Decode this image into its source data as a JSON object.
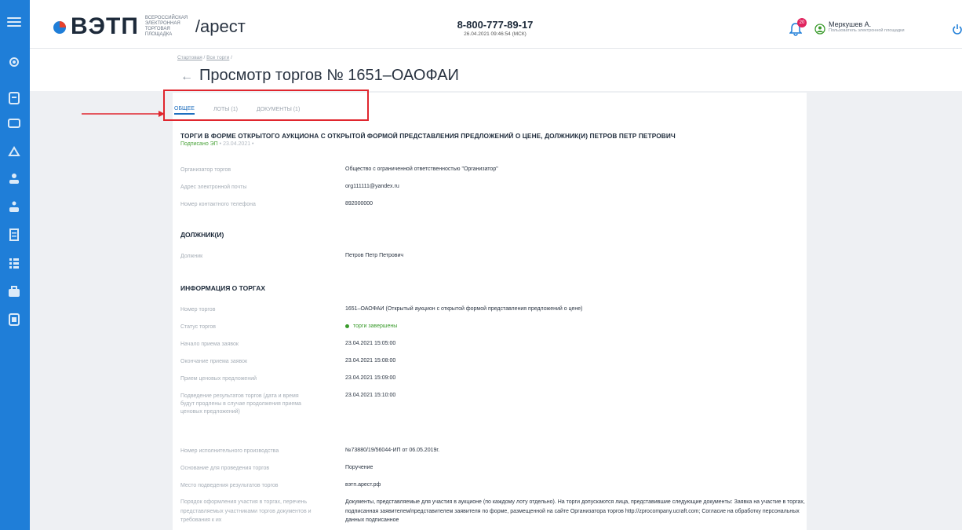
{
  "header": {
    "brand": "ВЭТП",
    "brand_small": "Всероссийская электронная торговая площадка",
    "section": "/арест",
    "phone": "8-800-777-89-17",
    "datetime": "26.04.2021 09:46:54 (МСК)",
    "notifications_badge": "20",
    "user_name": "Меркушев А.",
    "user_role": "Пользователь электронной площадки"
  },
  "breadcrumbs": [
    "Стартовая",
    "Все торги"
  ],
  "page_title": "Просмотр торгов № 1651–ОАОФАИ",
  "tabs": [
    {
      "label": "ОБЩЕЕ",
      "active": true
    },
    {
      "label": "ЛОТЫ (1)",
      "active": false
    },
    {
      "label": "ДОКУМЕНТЫ (1)",
      "active": false
    }
  ],
  "main": {
    "title": "ТОРГИ В ФОРМЕ ОТКРЫТОГО АУКЦИОНА С ОТКРЫТОЙ ФОРМОЙ ПРЕДСТАВЛЕНИЯ ПРЕДЛОЖЕНИЙ О ЦЕНЕ, ДОЛЖНИК(И) ПЕТРОВ ПЕТР ПЕТРОВИЧ",
    "signed": "Подписано ЭП",
    "signed_date": "• 23.04.2021 •",
    "organizer": [
      {
        "label": "Организатор торгов",
        "value": "Общество с ограниченной ответственностью \"Организатор\""
      },
      {
        "label": "Адрес электронной почты",
        "value": "org111111@yandex.ru"
      },
      {
        "label": "Номер контактного телефона",
        "value": "892000000"
      }
    ],
    "debtors_title": "ДОЛЖНИК(И)",
    "debtor": {
      "label": "Должник",
      "value": "Петров Петр Петрович"
    },
    "info_title": "ИНФОРМАЦИЯ О ТОРГАХ",
    "info": [
      {
        "label": "Номер торгов",
        "value": "1651–ОАОФАИ (Открытый аукцион с открытой формой представления предложений о цене)"
      },
      {
        "label": "Статус торгов",
        "value": "торги завершены"
      },
      {
        "label": "Начало приема заявок",
        "value": "23.04.2021 15:05:00"
      },
      {
        "label": "Окончание приема заявок",
        "value": "23.04.2021 15:08:00"
      },
      {
        "label": "Прием ценовых предложений",
        "value": "23.04.2021 15:09:00"
      },
      {
        "label": "Подведение результатов торгов (дата и время будут продлены в случае продолжения приема ценовых предложений)",
        "value": "23.04.2021 15:10:00"
      },
      {
        "label": "Номер исполнительного производства",
        "value": "№73880/19/56044-ИП от 06.05.2019г."
      },
      {
        "label": "Основание для проведения торгов",
        "value": "Поручение"
      },
      {
        "label": "Место подведения результатов торгов",
        "value": "вэтп.арест.рф"
      },
      {
        "label": "Порядок оформления участия в торгах, перечень представляемых участниками торгов документов и требования к их",
        "value": "Документы, представляемые для участия в аукционе (по каждому лоту отдельно). На торги допускаются лица, представившие следующие документы: Заявка на участие в торгах, подписанная заявителем/представителем заявителя по форме, размещенной на сайте Организатора торгов http://zprocompany.ucraft.com; Согласие на обработку персональных данных подписанное"
      }
    ]
  },
  "colors": {
    "rail": "#1f7ed8",
    "accent": "#1f6fbf",
    "status_green": "#3a9b2c",
    "highlight_red": "#e0262e"
  }
}
